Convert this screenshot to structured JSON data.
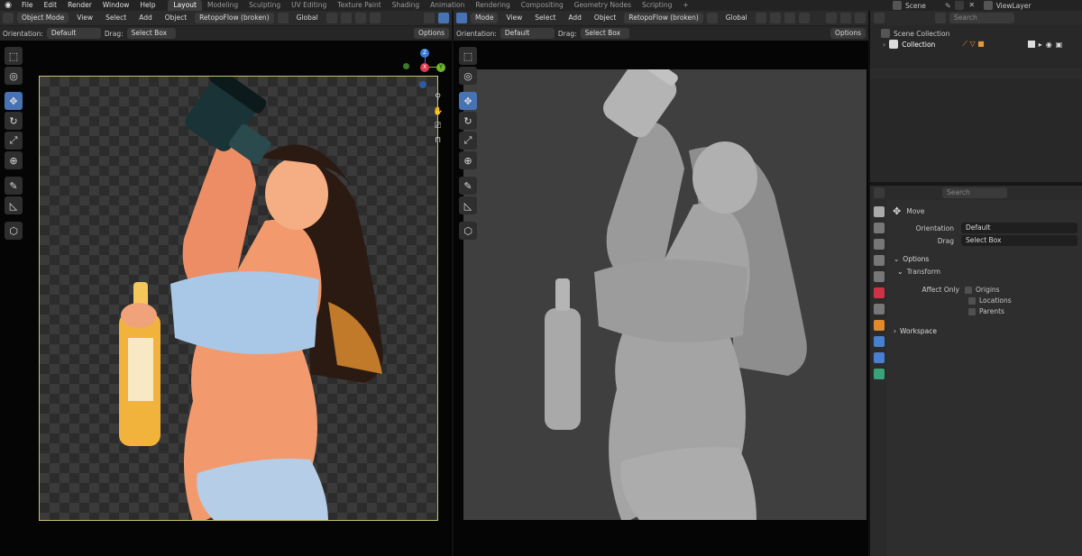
{
  "topbar": {
    "menus": [
      "File",
      "Edit",
      "Render",
      "Window",
      "Help"
    ],
    "workspaces": [
      "Layout",
      "Modeling",
      "Sculpting",
      "UV Editing",
      "Texture Paint",
      "Shading",
      "Animation",
      "Rendering",
      "Compositing",
      "Geometry Nodes",
      "Scripting"
    ],
    "active_workspace": "Layout",
    "add_tab": "+",
    "scene": "Scene",
    "view_layer": "ViewLayer"
  },
  "left_viewport": {
    "mode": "Object Mode",
    "menus": [
      "View",
      "Select",
      "Add",
      "Object"
    ],
    "addon": "RetopoFlow (broken)",
    "transform": "Global",
    "orientation_label": "Orientation:",
    "orientation_value": "Default",
    "drag_label": "Drag:",
    "drag_value": "Select Box",
    "options": "Options",
    "gizmo": {
      "x": "X",
      "y": "Y",
      "z": "Z"
    }
  },
  "right_viewport": {
    "mode": "Mode",
    "menus": [
      "View",
      "Select",
      "Add",
      "Object"
    ],
    "addon": "RetopoFlow (broken)",
    "transform": "Global",
    "orientation_label": "Orientation:",
    "orientation_value": "Default",
    "drag_label": "Drag:",
    "drag_value": "Select Box",
    "options": "Options"
  },
  "outliner": {
    "search_placeholder": "Search",
    "scene_collection": "Scene Collection",
    "collection": "Collection"
  },
  "properties": {
    "search_placeholder": "Search",
    "tool_name": "Move",
    "orientation_label": "Orientation",
    "orientation_value": "Default",
    "drag_label": "Drag",
    "drag_value": "Select Box",
    "options_section": "Options",
    "transform_section": "Transform",
    "affect_only_label": "Affect Only",
    "affect_items": [
      "Origins",
      "Locations",
      "Parents"
    ],
    "workspace_section": "Workspace"
  },
  "colors": {
    "accent": "#4772b3",
    "gizmo_x": "#e0394d",
    "gizmo_y": "#6fb52c",
    "gizmo_z": "#3b7ad9",
    "selection_outline": "#c9c36a"
  }
}
